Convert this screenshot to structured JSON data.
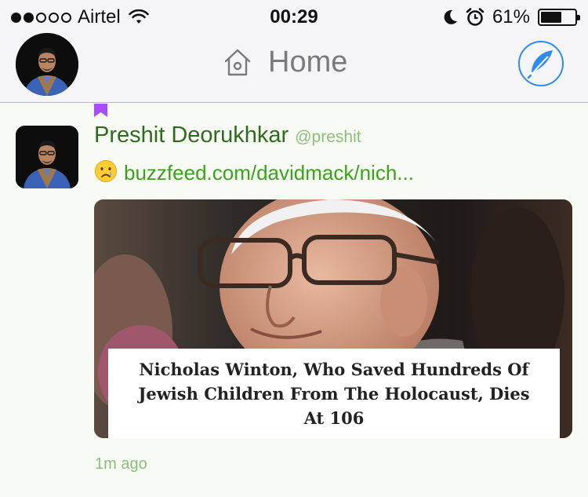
{
  "status_bar": {
    "carrier": "Airtel",
    "time": "00:29",
    "battery_percent": "61%",
    "battery_level": 0.61,
    "signal_bars_filled": 2,
    "signal_bars_total": 5
  },
  "nav": {
    "title": "Home",
    "icons": [
      "avatar",
      "home-icon",
      "compose-feather-icon"
    ],
    "accent_color": "#2d8cf0"
  },
  "tweet": {
    "author_name": "Preshit Deorukhkar",
    "author_handle": "@preshit",
    "emoji": "😢",
    "link_text": "buzzfeed.com/davidmack/nich...",
    "card_headline": "Nicholas Winton, Who Saved Hundreds Of Jewish Children From The Holocaust, Dies At 106",
    "timestamp": "1m ago",
    "name_color": "#2f6b1f",
    "link_color": "#3aa31c",
    "marker_color": "#a64dff"
  }
}
